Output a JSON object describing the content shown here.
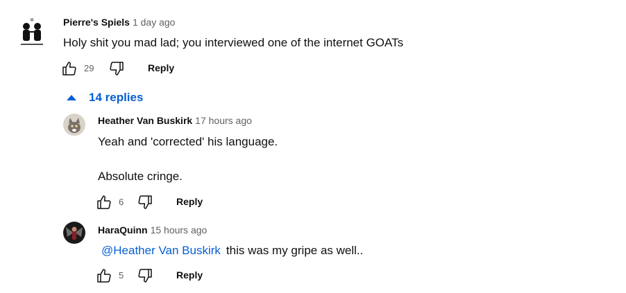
{
  "comments": [
    {
      "author": "Pierre's Spiels",
      "time": "1 day ago",
      "text": "Holy shit you mad lad; you interviewed one of the internet GOATs",
      "likes": "29",
      "reply_label": "Reply"
    }
  ],
  "replies_toggle": {
    "label": "14 replies"
  },
  "replies": [
    {
      "author": "Heather Van Buskirk",
      "time": "17 hours ago",
      "text_lines": [
        "Yeah and 'corrected' his language.",
        "Absolute cringe."
      ],
      "likes": "6",
      "reply_label": "Reply"
    },
    {
      "author": "HaraQuinn",
      "time": "15 hours ago",
      "mention": "@Heather Van Buskirk",
      "text": "this was my gripe as well..",
      "likes": "5",
      "reply_label": "Reply"
    }
  ],
  "icons": {
    "like": "thumbs-up-icon",
    "dislike": "thumbs-down-icon",
    "expand": "caret-up-icon"
  },
  "colors": {
    "link": "#065fd4",
    "secondary_text": "#606060",
    "primary_text": "#0f0f0f"
  }
}
